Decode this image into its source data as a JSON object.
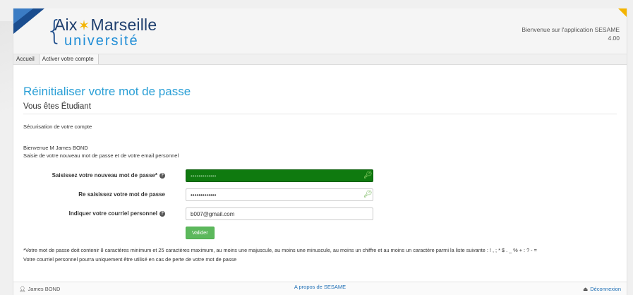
{
  "header": {
    "logo_line1_a": "Aix",
    "logo_line1_b": "Marseille",
    "logo_line2": "université",
    "welcome_app": "Bienvenue sur l'application SESAME",
    "version": "4.00"
  },
  "tabs": [
    {
      "label": "Accueil"
    },
    {
      "label": "Activer votre compte"
    }
  ],
  "page": {
    "title": "Réinitialiser votre mot de passe",
    "subtitle": "Vous êtes Étudiant",
    "section": "Sécurisation de votre compte",
    "welcome_user": "Bienvenue M James BOND",
    "instruction": "Saisie de votre nouveau mot de passe et de votre email personnel"
  },
  "form": {
    "new_password_label": "Saisissez votre nouveau mot de passe*",
    "new_password_value": "•••••••••••••",
    "confirm_label": "Re saisissez votre mot de passe",
    "confirm_value": "•••••••••••••",
    "email_label": "Indiquer votre courriel personnel",
    "email_value": "b007@gmail.com",
    "submit_label": "Valider"
  },
  "notes": {
    "rule": "*Votre mot de passe doit contenir 8 caractères minimum et 25 caractères maximum, au moins une majuscule, au moins une minuscule, au moins un chiffre et au moins un caractère parmi la liste suivante : ! , ; * $ . _ % + : ? - =",
    "email_usage": "Votre courriel personnel pourra uniquement être utilisé en cas de perte de votre mot de passe"
  },
  "footer": {
    "user": "James BOND",
    "about": "A propos de SESAME",
    "logout": "Déconnexion"
  },
  "colors": {
    "accent": "#2a9fd6",
    "valid_field": "#0f7a0f",
    "button": "#5cb85c"
  }
}
